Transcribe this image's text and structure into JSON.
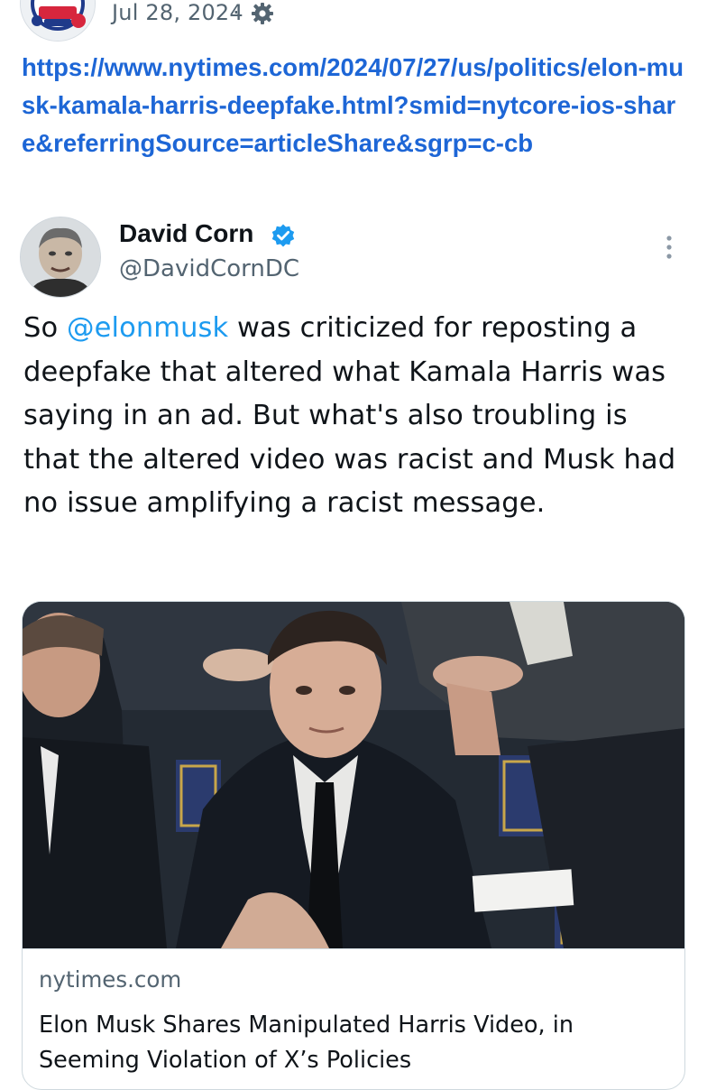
{
  "outer_post": {
    "avatar_icon": "vote-badge-avatar",
    "date": "Jul 28, 2024",
    "separator": "·",
    "settings_icon": "gear-icon",
    "url": "https://www.nytimes.com/2024/07/27/us/politics/elon-musk-kamala-harris-deepfake.html?smid=nytcore-ios-share&referringSource=articleShare&sgrp=c-cb"
  },
  "quoted_tweet": {
    "author_name": "David Corn",
    "verified_icon": "verified-badge-icon",
    "handle": "@DavidCornDC",
    "more_icon": "more-vertical-icon",
    "text_before_mention": "So ",
    "mention": "@elonmusk",
    "text_after_mention": " was criticized for reposting a deepfake that altered what Kamala Harris was saying in an ad. But what's also troubling is that the altered video was racist and Musk had no issue amplifying a racist message."
  },
  "link_card": {
    "image_icon": "article-photo",
    "domain": "nytimes.com",
    "title": "Elon Musk Shares Manipulated Harris Video, in Seeming Violation of X’s Policies"
  },
  "colors": {
    "link_blue": "#1d66d6",
    "mention_blue": "#1d9bf0",
    "verified_blue": "#1d9bf0",
    "secondary_text": "#536471",
    "primary_text": "#0f1419",
    "card_border": "#cfd9de"
  }
}
